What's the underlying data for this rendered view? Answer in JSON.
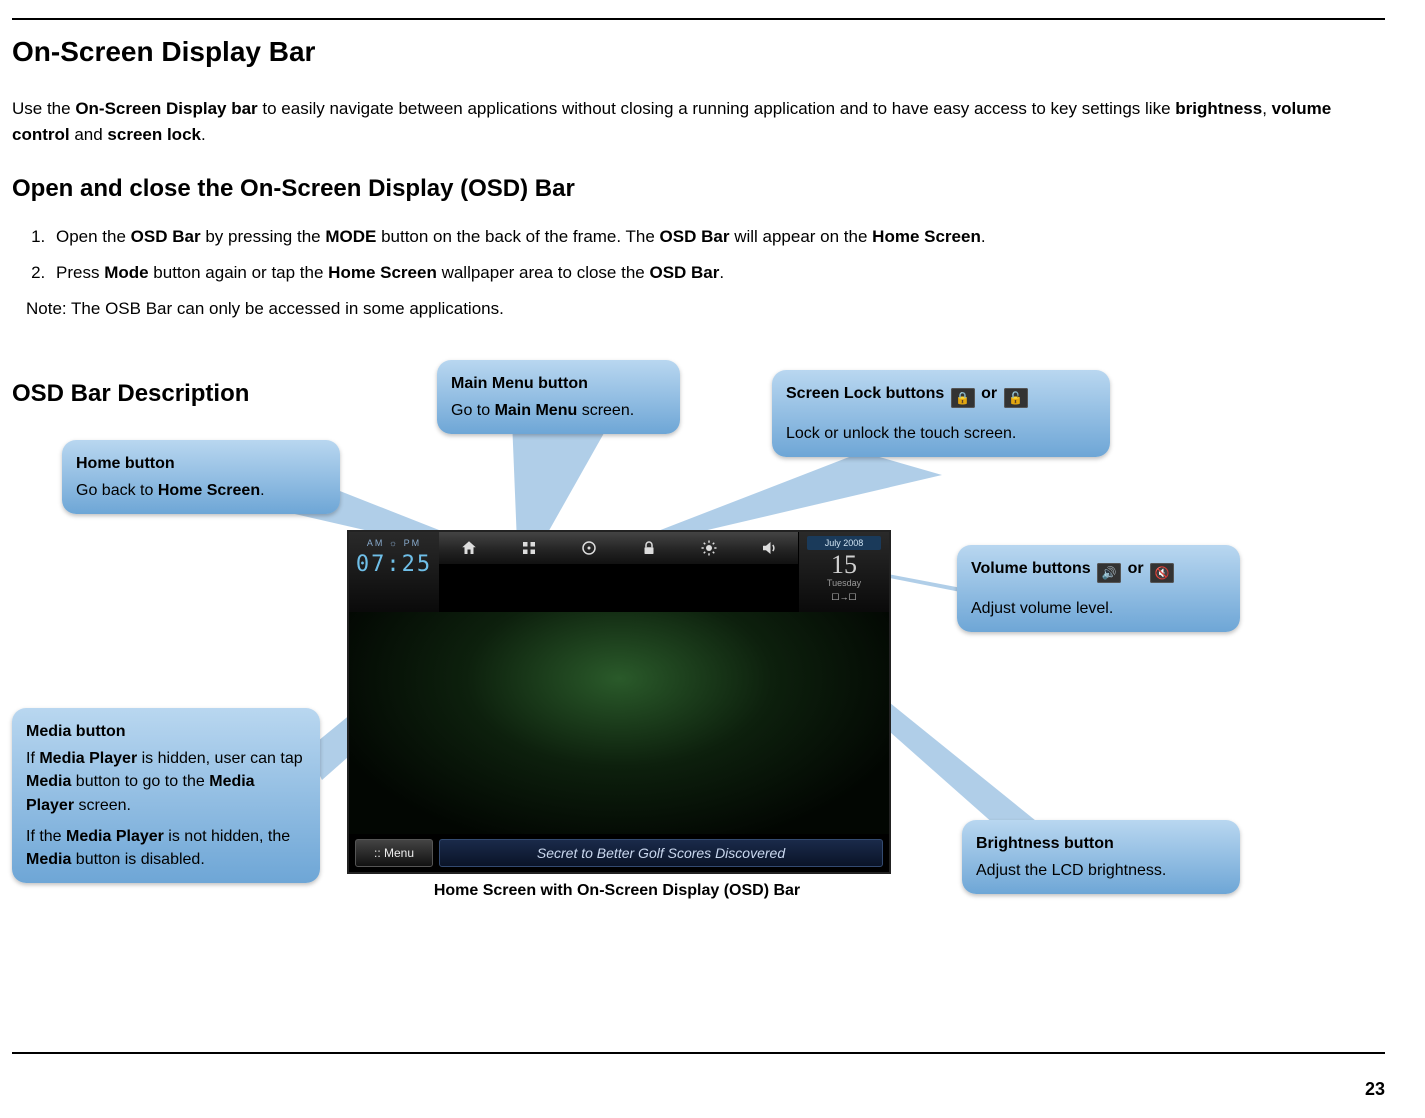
{
  "page": {
    "title": "On-Screen Display Bar",
    "intro_pre": "Use the ",
    "intro_b1": "On-Screen Display bar",
    "intro_mid1": " to easily navigate between applications without closing a running application and to have easy access to key settings like ",
    "intro_b2": "brightness",
    "intro_c1": ", ",
    "intro_b3": "volume control",
    "intro_c2": " and ",
    "intro_b4": "screen lock",
    "intro_post": ".",
    "h2_open": "Open and close the On-Screen Display (OSD) Bar",
    "step1_a": "Open the ",
    "step1_b1": "OSD Bar",
    "step1_b": " by pressing the ",
    "step1_b2": "MODE",
    "step1_c": " button on the back of the frame.  The ",
    "step1_b3": "OSD Bar",
    "step1_d": " will appear on the ",
    "step1_b4": "Home Screen",
    "step1_e": ".",
    "step2_a": "Press ",
    "step2_b1": "Mode",
    "step2_b": " button again or tap the ",
    "step2_b2": "Home Screen",
    "step2_c": " wallpaper area to close the ",
    "step2_b3": "OSD Bar",
    "step2_d": ".",
    "note": "Note: The OSB Bar can only be accessed in some applications.",
    "h2_desc": "OSD Bar Description",
    "caption": "Home Screen with On-Screen Display (OSD) Bar",
    "pagenum": "23"
  },
  "callouts": {
    "home": {
      "title": "Home button",
      "txt_a": "Go back to ",
      "txt_b": "Home Screen",
      "txt_c": "."
    },
    "main": {
      "title": "Main Menu button",
      "txt_a": "Go to ",
      "txt_b": "Main Menu",
      "txt_c": " screen."
    },
    "lock": {
      "title_a": "Screen Lock buttons ",
      "or": " or ",
      "body": "Lock or unlock the touch screen."
    },
    "volume": {
      "title_a": "Volume buttons ",
      "or": " or ",
      "body": "Adjust volume level."
    },
    "brightness": {
      "title": "Brightness button",
      "body": "Adjust the LCD brightness."
    },
    "media": {
      "title": "Media button",
      "p1_a": "If ",
      "p1_b": "Media Player",
      "p1_c": " is hidden, user can tap ",
      "p1_d": "Media",
      "p1_e": " button to go to the ",
      "p1_f": "Media Player",
      "p1_g": " screen.",
      "p2_a": "If the ",
      "p2_b": "Media Player",
      "p2_c": " is not hidden, the ",
      "p2_d": "Media",
      "p2_e": " button is disabled."
    }
  },
  "device": {
    "ampm": "AM  ☼  PM",
    "clock": "07:25",
    "month": "July  2008",
    "day": "15",
    "dow": "Tuesday",
    "cv": "☐→☐",
    "menu_label": ":: Menu",
    "ticker": "Secret to Better Golf Scores Discovered"
  },
  "icons": {
    "lock": "🔒",
    "unlock": "🔓",
    "vol": "🔊",
    "mute": "🔇"
  }
}
